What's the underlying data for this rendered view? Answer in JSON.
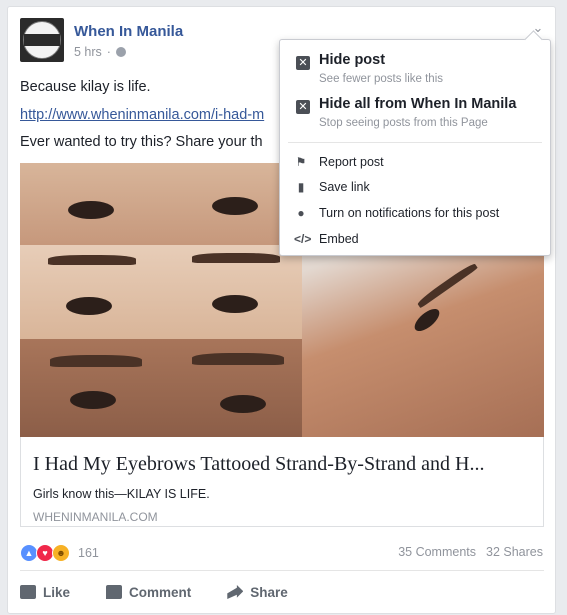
{
  "post": {
    "page_name": "When In Manila",
    "avatar_text": "WHEN IN MANILA",
    "timestamp": "5 hrs",
    "separator": "·",
    "line1": "Because kilay is life.",
    "link": "http://www.wheninmanila.com/i-had-m",
    "line3": "Ever wanted to try this? Share your th"
  },
  "link_preview": {
    "title": "I Had My Eyebrows Tattooed Strand-By-Strand and H...",
    "description": "Girls know this—KILAY IS LIFE.",
    "domain": "WHENINMANILA.COM"
  },
  "stats": {
    "reaction_count": "161",
    "comments": "35 Comments",
    "shares": "32 Shares"
  },
  "actions": {
    "like": "Like",
    "comment": "Comment",
    "share": "Share"
  },
  "menu": {
    "hide_post": {
      "title": "Hide post",
      "subtitle": "See fewer posts like this"
    },
    "hide_all": {
      "title": "Hide all from When In Manila",
      "subtitle": "Stop seeing posts from this Page"
    },
    "report": "Report post",
    "save": "Save link",
    "notifications": "Turn on notifications for this post",
    "embed": "Embed"
  },
  "icons": {
    "chevron": "chevron-down-icon",
    "globe": "globe-icon",
    "hide": "close-box-icon",
    "hide_all": "hide-all-icon",
    "report": "report-icon",
    "save": "bookmark-icon",
    "notifications": "globe-icon",
    "embed": "code-icon"
  },
  "colors": {
    "link_blue": "#365899",
    "like_blue": "#5890ff",
    "love_red": "#f0284a",
    "haha_yellow": "#f7b125",
    "muted_gray": "#90949c"
  }
}
